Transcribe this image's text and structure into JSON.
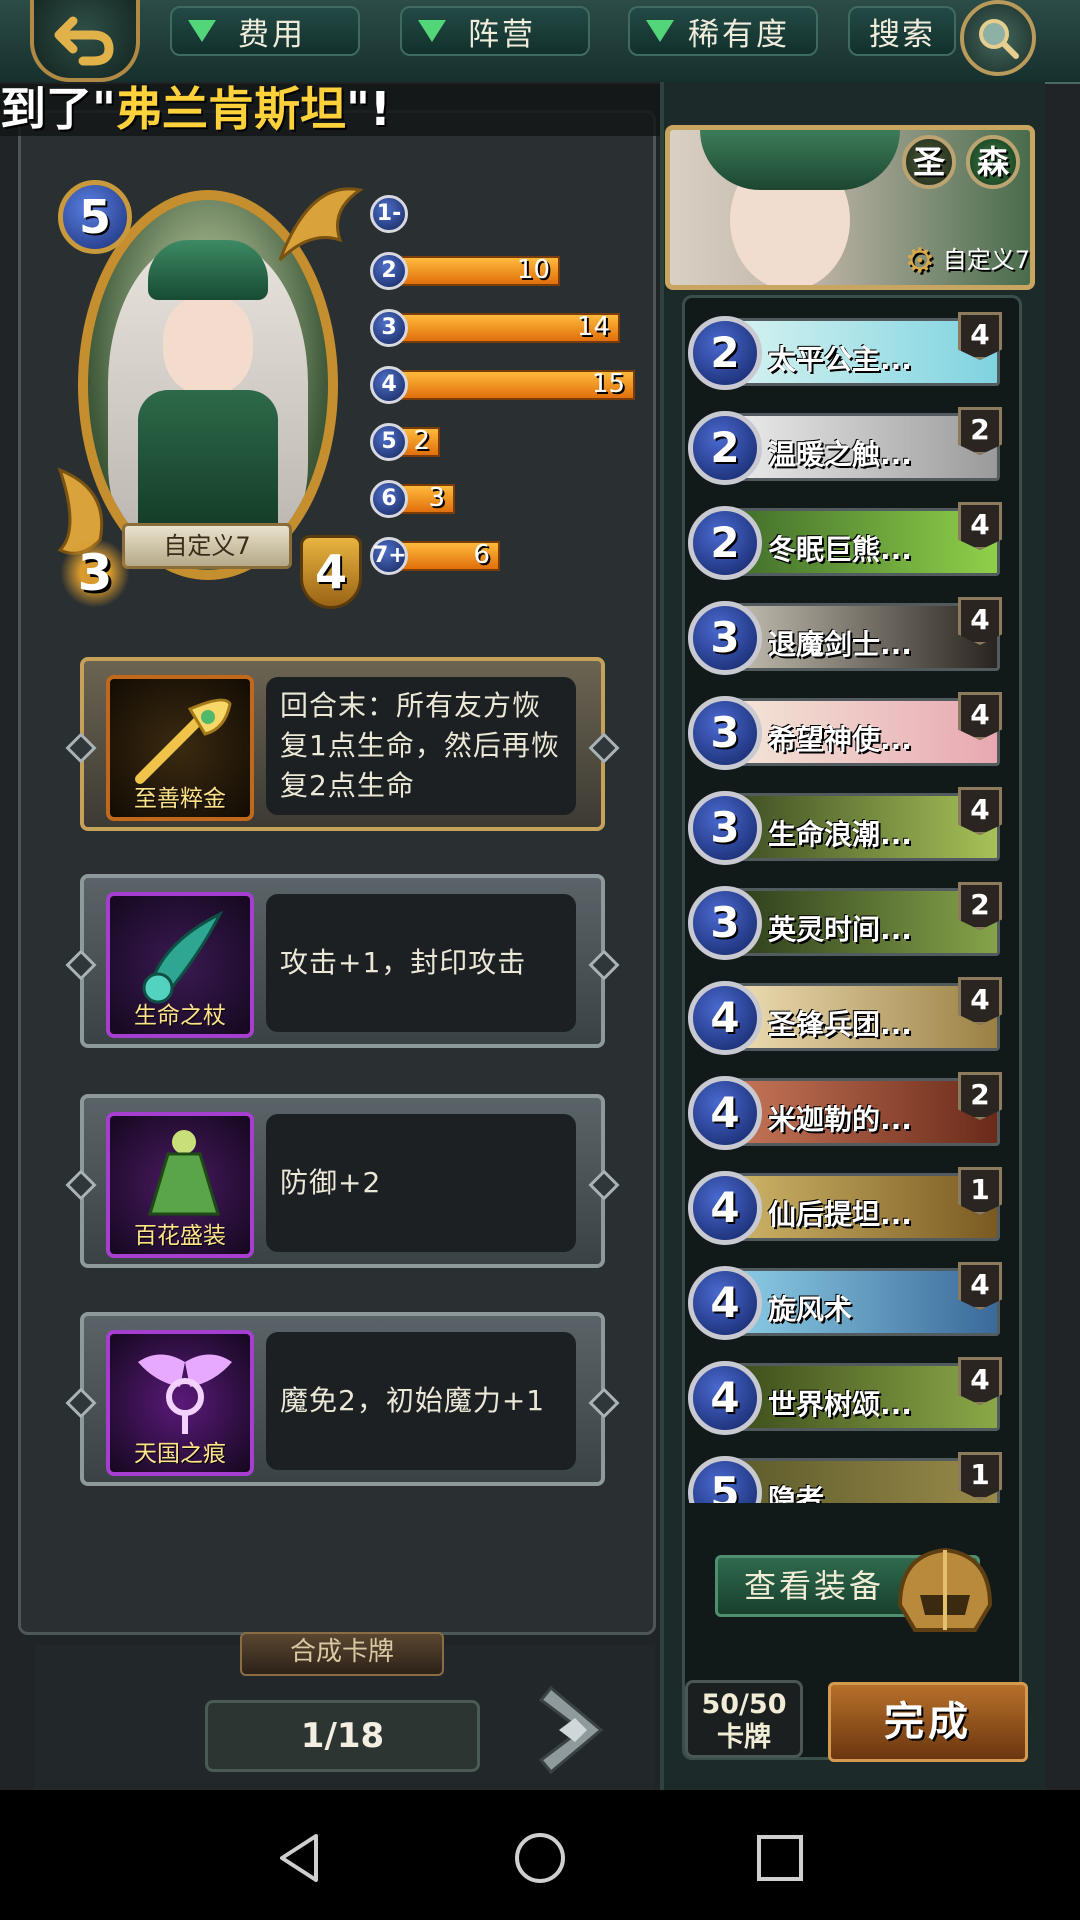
{
  "toolbar": {
    "filters": [
      "费用",
      "阵营",
      "稀有度"
    ],
    "search_label": "搜索"
  },
  "notice": {
    "prefix": "到了\"",
    "highlight": "弗兰肯斯坦",
    "suffix": "\"!"
  },
  "card": {
    "name": "自定义7",
    "cost": "5",
    "attack": "3",
    "health": "4"
  },
  "mana_curve": [
    {
      "label": "1-",
      "value": 0
    },
    {
      "label": "2",
      "value": 10
    },
    {
      "label": "3",
      "value": 14
    },
    {
      "label": "4",
      "value": 15
    },
    {
      "label": "5",
      "value": 2
    },
    {
      "label": "6",
      "value": 3
    },
    {
      "label": "7+",
      "value": 6
    }
  ],
  "equipment": [
    {
      "name": "至善粹金",
      "desc": "回合末：所有友方恢复1点生命，然后再恢复2点生命"
    },
    {
      "name": "生命之杖",
      "desc": "攻击+1，封印攻击"
    },
    {
      "name": "百花盛装",
      "desc": "防御+2"
    },
    {
      "name": "天国之痕",
      "desc": "魔免2，初始魔力+1"
    }
  ],
  "merge_tab": "合成卡牌",
  "pagination": "1/18",
  "hero": {
    "name": "自定义7",
    "factions": [
      "圣",
      "森"
    ]
  },
  "deck": [
    {
      "cost": "2",
      "name": "太平公主...",
      "count": "4"
    },
    {
      "cost": "2",
      "name": "温暖之触...",
      "count": "2"
    },
    {
      "cost": "2",
      "name": "冬眠巨熊...",
      "count": "4"
    },
    {
      "cost": "3",
      "name": "退魔剑士...",
      "count": "4"
    },
    {
      "cost": "3",
      "name": "希望神使...",
      "count": "4"
    },
    {
      "cost": "3",
      "name": "生命浪潮...",
      "count": "4"
    },
    {
      "cost": "3",
      "name": "英灵时间...",
      "count": "2"
    },
    {
      "cost": "4",
      "name": "圣锋兵团...",
      "count": "4"
    },
    {
      "cost": "4",
      "name": "米迦勒的...",
      "count": "2"
    },
    {
      "cost": "4",
      "name": "仙后提坦...",
      "count": "1"
    },
    {
      "cost": "4",
      "name": "旋风术",
      "count": "4"
    },
    {
      "cost": "4",
      "name": "世界树颂...",
      "count": "4"
    },
    {
      "cost": "5",
      "name": "隐者",
      "count": "1"
    }
  ],
  "view_equipment_label": "查看装备",
  "deck_counter": {
    "count": "50/50",
    "label": "卡牌"
  },
  "done_label": "完成"
}
